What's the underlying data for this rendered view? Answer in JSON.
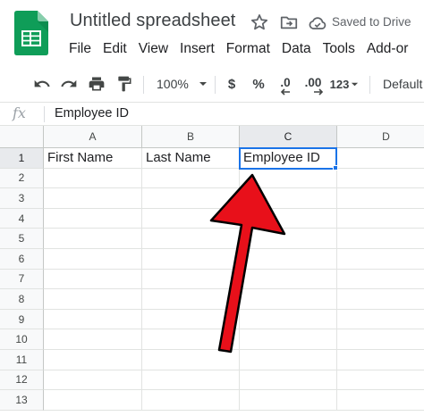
{
  "app": {
    "document_title": "Untitled spreadsheet",
    "save_status": "Saved to Drive"
  },
  "menu": {
    "items": [
      "File",
      "Edit",
      "View",
      "Insert",
      "Format",
      "Data",
      "Tools",
      "Add-or"
    ]
  },
  "toolbar": {
    "zoom": "100%",
    "currency_symbol": "$",
    "percent_symbol": "%",
    "decrease_decimal": ".0",
    "increase_decimal": ".00",
    "more_formats": "123",
    "font_name": "Default"
  },
  "formula_bar": {
    "fx_label": "fx",
    "value": "Employee ID"
  },
  "grid": {
    "columns": [
      "A",
      "B",
      "C",
      "D"
    ],
    "rows": [
      "1",
      "2",
      "3",
      "4",
      "5",
      "6",
      "7",
      "8",
      "9",
      "10",
      "11",
      "12",
      "13"
    ],
    "cells": {
      "A1": "First Name",
      "B1": "Last Name",
      "C1": "Employee ID"
    },
    "active_cell": "C1"
  },
  "colors": {
    "sheets_green": "#0f9d58",
    "selection_blue": "#1a73e8",
    "annotation_red": "#e8101a"
  },
  "icons": [
    "google-sheets-logo",
    "star-icon",
    "move-to-folder-icon",
    "cloud-saved-icon",
    "undo-icon",
    "redo-icon",
    "print-icon",
    "paint-format-icon",
    "dropdown-arrow-icon"
  ]
}
